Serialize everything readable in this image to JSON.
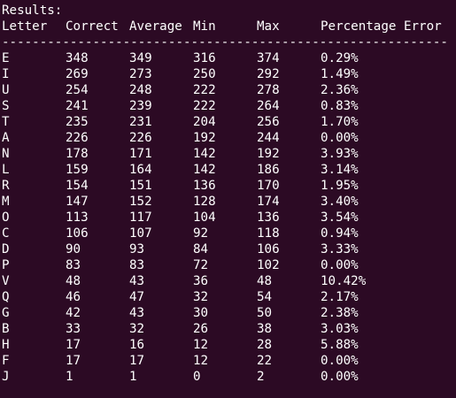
{
  "terminal": {
    "results_label": "Results:",
    "headers": [
      "Letter",
      "Correct",
      "Average",
      "Min",
      "Max",
      "Percentage Error"
    ],
    "divider": "----------------------------------------------------------------------",
    "rows": [
      {
        "letter": "E",
        "correct": "348",
        "average": "349",
        "min": "316",
        "max": "374",
        "error": "0.29%"
      },
      {
        "letter": "I",
        "correct": "269",
        "average": "273",
        "min": "250",
        "max": "292",
        "error": "1.49%"
      },
      {
        "letter": "U",
        "correct": "254",
        "average": "248",
        "min": "222",
        "max": "278",
        "error": "2.36%"
      },
      {
        "letter": "S",
        "correct": "241",
        "average": "239",
        "min": "222",
        "max": "264",
        "error": "0.83%"
      },
      {
        "letter": "T",
        "correct": "235",
        "average": "231",
        "min": "204",
        "max": "256",
        "error": "1.70%"
      },
      {
        "letter": "A",
        "correct": "226",
        "average": "226",
        "min": "192",
        "max": "244",
        "error": "0.00%"
      },
      {
        "letter": "N",
        "correct": "178",
        "average": "171",
        "min": "142",
        "max": "192",
        "error": "3.93%"
      },
      {
        "letter": "L",
        "correct": "159",
        "average": "164",
        "min": "142",
        "max": "186",
        "error": "3.14%"
      },
      {
        "letter": "R",
        "correct": "154",
        "average": "151",
        "min": "136",
        "max": "170",
        "error": "1.95%"
      },
      {
        "letter": "M",
        "correct": "147",
        "average": "152",
        "min": "128",
        "max": "174",
        "error": "3.40%"
      },
      {
        "letter": "O",
        "correct": "113",
        "average": "117",
        "min": "104",
        "max": "136",
        "error": "3.54%"
      },
      {
        "letter": "C",
        "correct": "106",
        "average": "107",
        "min": "92",
        "max": "118",
        "error": "0.94%"
      },
      {
        "letter": "D",
        "correct": "90",
        "average": "93",
        "min": "84",
        "max": "106",
        "error": "3.33%"
      },
      {
        "letter": "P",
        "correct": "83",
        "average": "83",
        "min": "72",
        "max": "102",
        "error": "0.00%"
      },
      {
        "letter": "V",
        "correct": "48",
        "average": "43",
        "min": "36",
        "max": "48",
        "error": "10.42%"
      },
      {
        "letter": "Q",
        "correct": "46",
        "average": "47",
        "min": "32",
        "max": "54",
        "error": "2.17%"
      },
      {
        "letter": "G",
        "correct": "42",
        "average": "43",
        "min": "30",
        "max": "50",
        "error": "2.38%"
      },
      {
        "letter": "B",
        "correct": "33",
        "average": "32",
        "min": "26",
        "max": "38",
        "error": "3.03%"
      },
      {
        "letter": "H",
        "correct": "17",
        "average": "16",
        "min": "12",
        "max": "28",
        "error": "5.88%"
      },
      {
        "letter": "F",
        "correct": "17",
        "average": "17",
        "min": "12",
        "max": "22",
        "error": "0.00%"
      },
      {
        "letter": "J",
        "correct": "1",
        "average": "1",
        "min": "0",
        "max": "2",
        "error": "0.00%"
      }
    ]
  },
  "colors": {
    "background": "#2C0A24",
    "text": "#FFFFFF"
  }
}
